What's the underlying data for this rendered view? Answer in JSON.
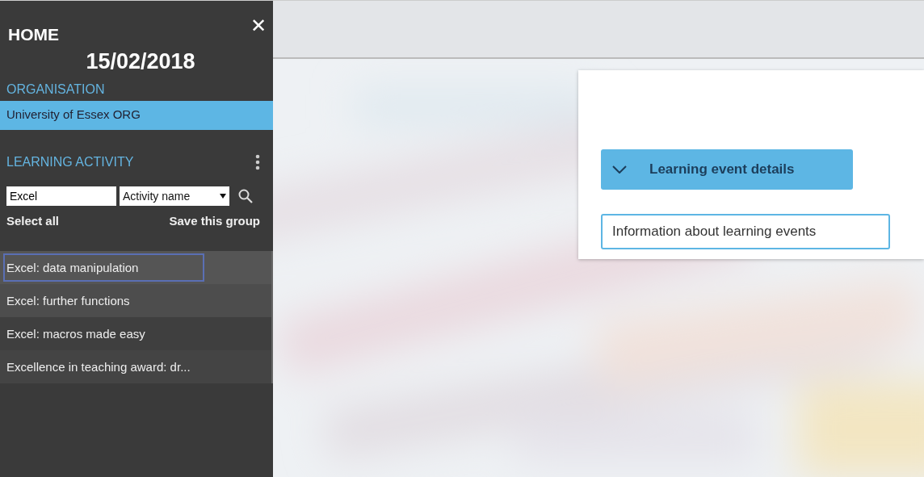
{
  "sidebar": {
    "title": "HOME",
    "close": "✕",
    "date": "15/02/2018",
    "organisation": {
      "heading": "ORGANISATION",
      "items": [
        {
          "label": "University of Essex ORG",
          "selected": true
        }
      ]
    },
    "learning_activity": {
      "heading": "LEARNING ACTIVITY",
      "search": {
        "value": "Excel"
      },
      "filter": {
        "value": "Activity name"
      },
      "select_all": "Select all",
      "save_group": "Save this group",
      "items": [
        {
          "label": "Excel: data manipulation",
          "selected": true
        },
        {
          "label": "Excel: further functions",
          "selected": false
        },
        {
          "label": "Excel: macros made easy",
          "selected": false
        },
        {
          "label": "Excellence in teaching award: dr...",
          "selected": false
        }
      ]
    }
  },
  "main": {
    "card": {
      "section": {
        "label": "Learning event details",
        "expanded": true
      },
      "field": {
        "value": "Information about learning events"
      }
    }
  }
}
